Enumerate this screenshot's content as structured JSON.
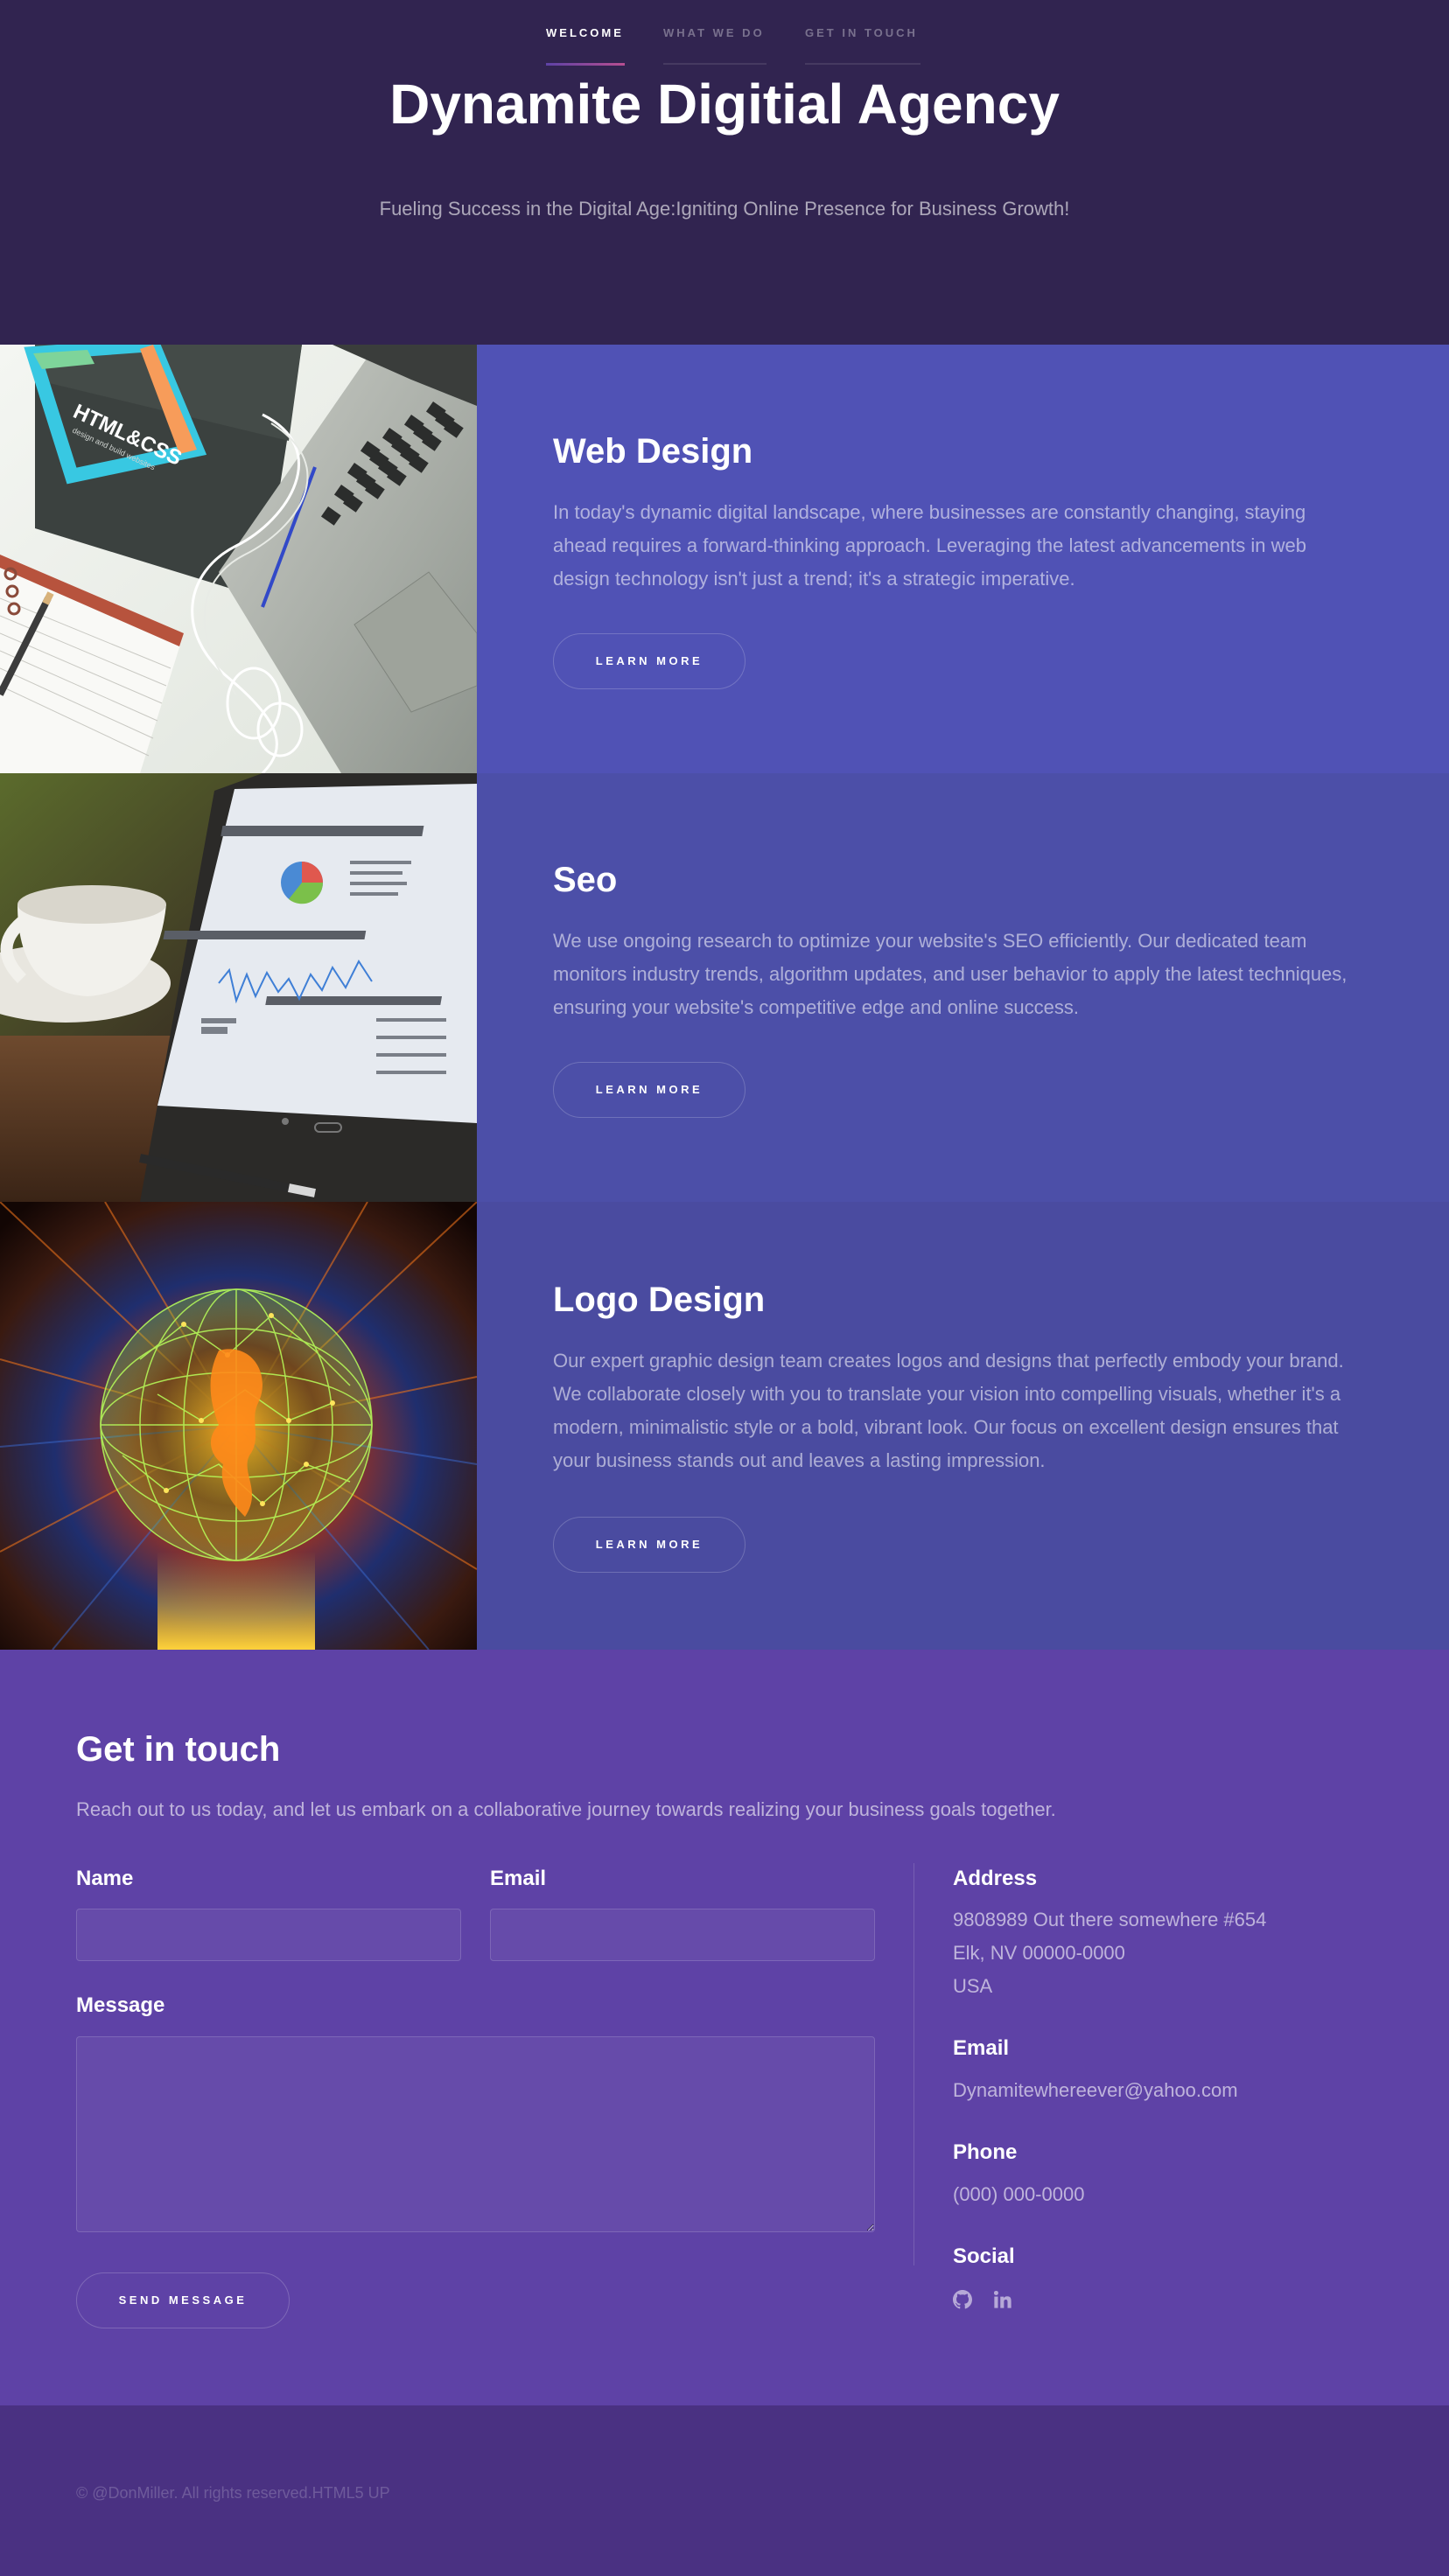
{
  "nav": {
    "items": [
      {
        "label": "WELCOME"
      },
      {
        "label": "WHAT WE DO"
      },
      {
        "label": "GET IN TOUCH"
      }
    ]
  },
  "hero": {
    "title": "Dynamite Digitial Agency",
    "subtitle": "Fueling Success in the Digital Age:Igniting Online Presence for Business Growth!"
  },
  "spotlights": [
    {
      "title": "Web Design",
      "text": "In today's dynamic digital landscape, where businesses are constantly changing, staying ahead requires a forward-thinking approach. Leveraging the latest advancements in web design technology isn't just a trend; it's a strategic imperative.",
      "button": "LEARN MORE",
      "image_labels": {
        "book": "HTML&CSS",
        "book_sub": "design and build websites"
      }
    },
    {
      "title": "Seo",
      "text": "We use ongoing research to optimize your website's SEO efficiently. Our dedicated team monitors industry trends, algorithm updates, and user behavior to apply the latest techniques, ensuring your website's competitive edge and online success.",
      "button": "LEARN MORE"
    },
    {
      "title": "Logo Design",
      "text": "Our expert graphic design team creates logos and designs that perfectly embody your brand. We collaborate closely with you to translate your vision into compelling visuals, whether it's a modern, minimalistic style or a bold, vibrant look. Our focus on excellent design ensures that your business stands out and leaves a lasting impression.",
      "button": "LEARN MORE"
    }
  ],
  "contact": {
    "title": "Get in touch",
    "intro": "Reach out to us today, and let us embark on a collaborative journey towards realizing your business goals together.",
    "form": {
      "name_label": "Name",
      "email_label": "Email",
      "message_label": "Message",
      "name_value": "",
      "email_value": "",
      "message_value": "",
      "submit": "SEND MESSAGE"
    },
    "info": {
      "address_heading": "Address",
      "address_lines": [
        "9808989 Out there somewhere #654",
        "Elk, NV 00000-0000",
        "USA"
      ],
      "email_heading": "Email",
      "email": "Dynamitewhereever@yahoo.com",
      "phone_heading": "Phone",
      "phone": "(000) 000-0000",
      "social_heading": "Social",
      "social_icons": [
        "github-icon",
        "linkedin-icon"
      ]
    }
  },
  "footer": {
    "text": "© @DonMiller. All rights reserved.HTML5 UP"
  },
  "colors": {
    "header_bg": "#312450",
    "spot1_bg": "#5052b5",
    "spot2_bg": "#4c4fa8",
    "spot3_bg": "#4a4ba0",
    "contact_bg": "#5e42a6",
    "footer_bg": "#4a3182",
    "nav_accent": "#b74e91"
  }
}
